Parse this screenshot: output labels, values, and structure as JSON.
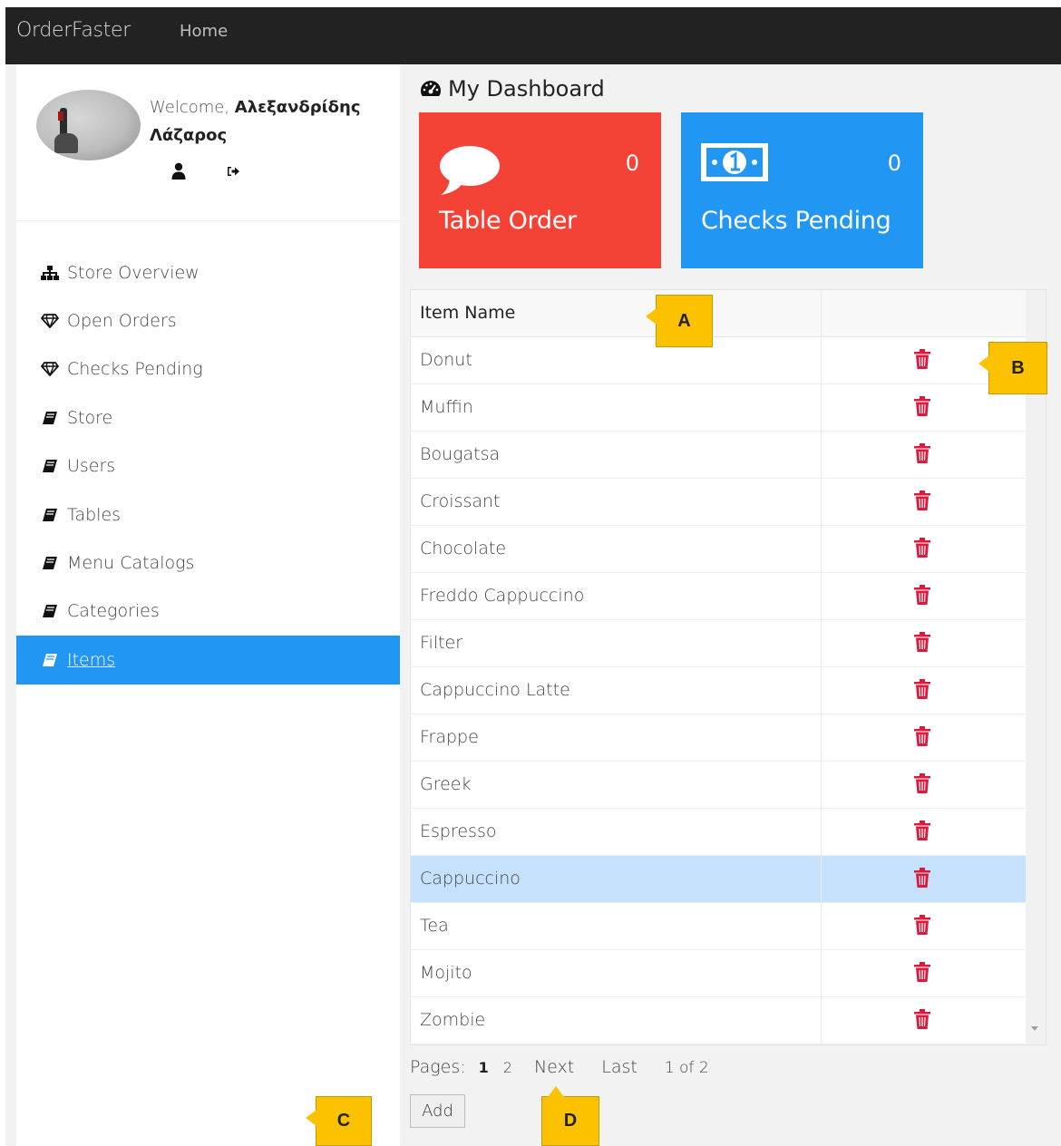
{
  "navbar": {
    "brand": "OrderFaster",
    "home": "Home"
  },
  "profile": {
    "welcome_prefix": "Welcome, ",
    "user_name": "Αλεξανδρίδης Λάζαρος"
  },
  "sidebar": {
    "items": [
      {
        "label": "Store Overview",
        "icon": "sitemap-icon",
        "active": false
      },
      {
        "label": "Open Orders",
        "icon": "diamond-icon",
        "active": false
      },
      {
        "label": "Checks Pending",
        "icon": "diamond-icon",
        "active": false
      },
      {
        "label": "Store",
        "icon": "book-icon",
        "active": false
      },
      {
        "label": "Users",
        "icon": "book-icon",
        "active": false
      },
      {
        "label": "Tables",
        "icon": "book-icon",
        "active": false
      },
      {
        "label": "Menu Catalogs",
        "icon": "book-icon",
        "active": false
      },
      {
        "label": "Categories",
        "icon": "book-icon",
        "active": false
      },
      {
        "label": "Items",
        "icon": "book-icon",
        "active": true
      }
    ]
  },
  "dashboard": {
    "title": "My Dashboard",
    "cards": [
      {
        "label": "Table Order",
        "count": "0",
        "color": "#f44336",
        "icon": "speech-bubble-icon"
      },
      {
        "label": "Checks Pending",
        "count": "0",
        "color": "#2196f3",
        "icon": "money-bill-icon"
      }
    ]
  },
  "table": {
    "header_name": "Item Name",
    "rows": [
      {
        "name": "Donut",
        "selected": false
      },
      {
        "name": "Muffin",
        "selected": false
      },
      {
        "name": "Bougatsa",
        "selected": false
      },
      {
        "name": "Croissant",
        "selected": false
      },
      {
        "name": "Chocolate",
        "selected": false
      },
      {
        "name": "Freddo Cappuccino",
        "selected": false
      },
      {
        "name": "Filter",
        "selected": false
      },
      {
        "name": "Cappuccino Latte",
        "selected": false
      },
      {
        "name": "Frappe",
        "selected": false
      },
      {
        "name": "Greek",
        "selected": false
      },
      {
        "name": "Espresso",
        "selected": false
      },
      {
        "name": "Cappuccino",
        "selected": true
      },
      {
        "name": "Tea",
        "selected": false
      },
      {
        "name": "Mojito",
        "selected": false
      },
      {
        "name": "Zombie",
        "selected": false
      }
    ],
    "delete_icon": "trash-icon",
    "delete_color": "#d81b3c"
  },
  "pager": {
    "label": "Pages:",
    "page1": "1",
    "page2": "2",
    "next": "Next",
    "last": "Last",
    "of": "1 of 2"
  },
  "add_button": "Add",
  "callouts": {
    "a": "A",
    "b": "B",
    "c": "C",
    "d": "D"
  }
}
